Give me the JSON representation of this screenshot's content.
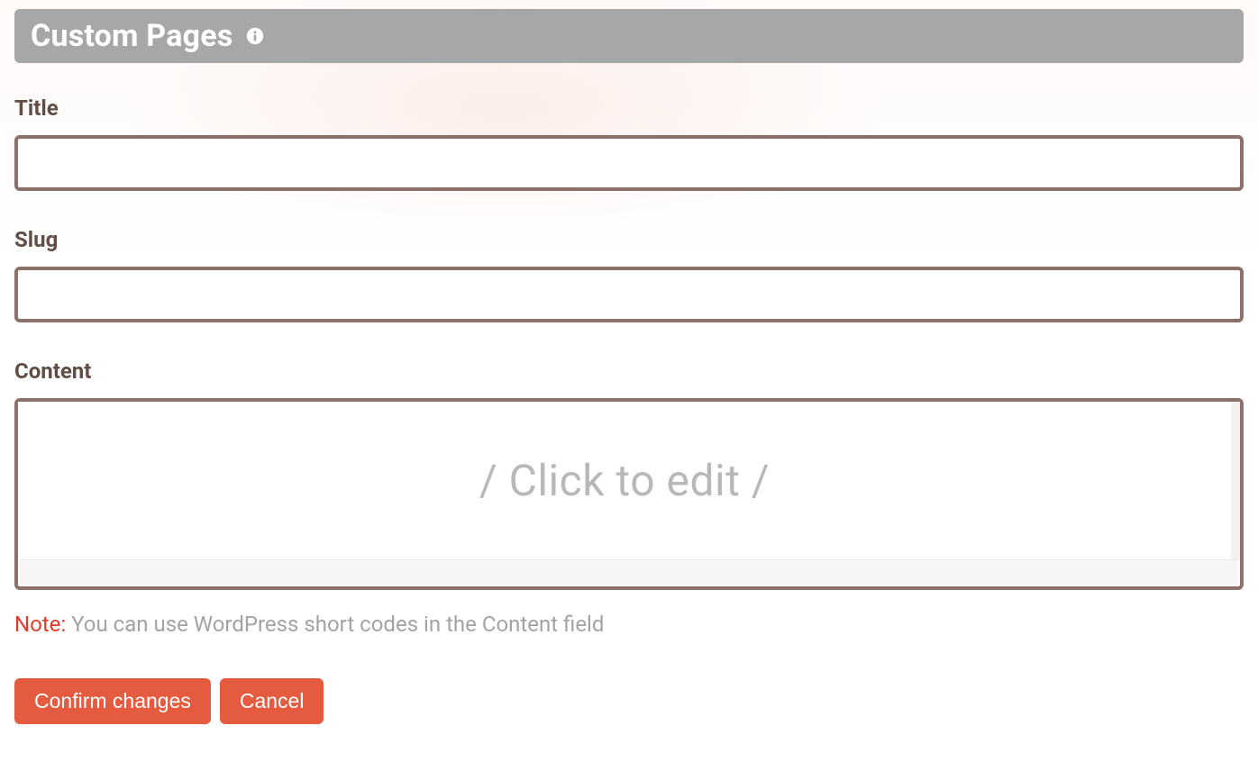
{
  "header": {
    "title": "Custom Pages"
  },
  "fields": {
    "title": {
      "label": "Title",
      "value": ""
    },
    "slug": {
      "label": "Slug",
      "value": ""
    },
    "content": {
      "label": "Content",
      "placeholder": "/ Click to edit /"
    }
  },
  "note": {
    "label": "Note:",
    "text": " You can use WordPress short codes in the Content field"
  },
  "buttons": {
    "confirm": "Confirm changes",
    "cancel": "Cancel"
  }
}
